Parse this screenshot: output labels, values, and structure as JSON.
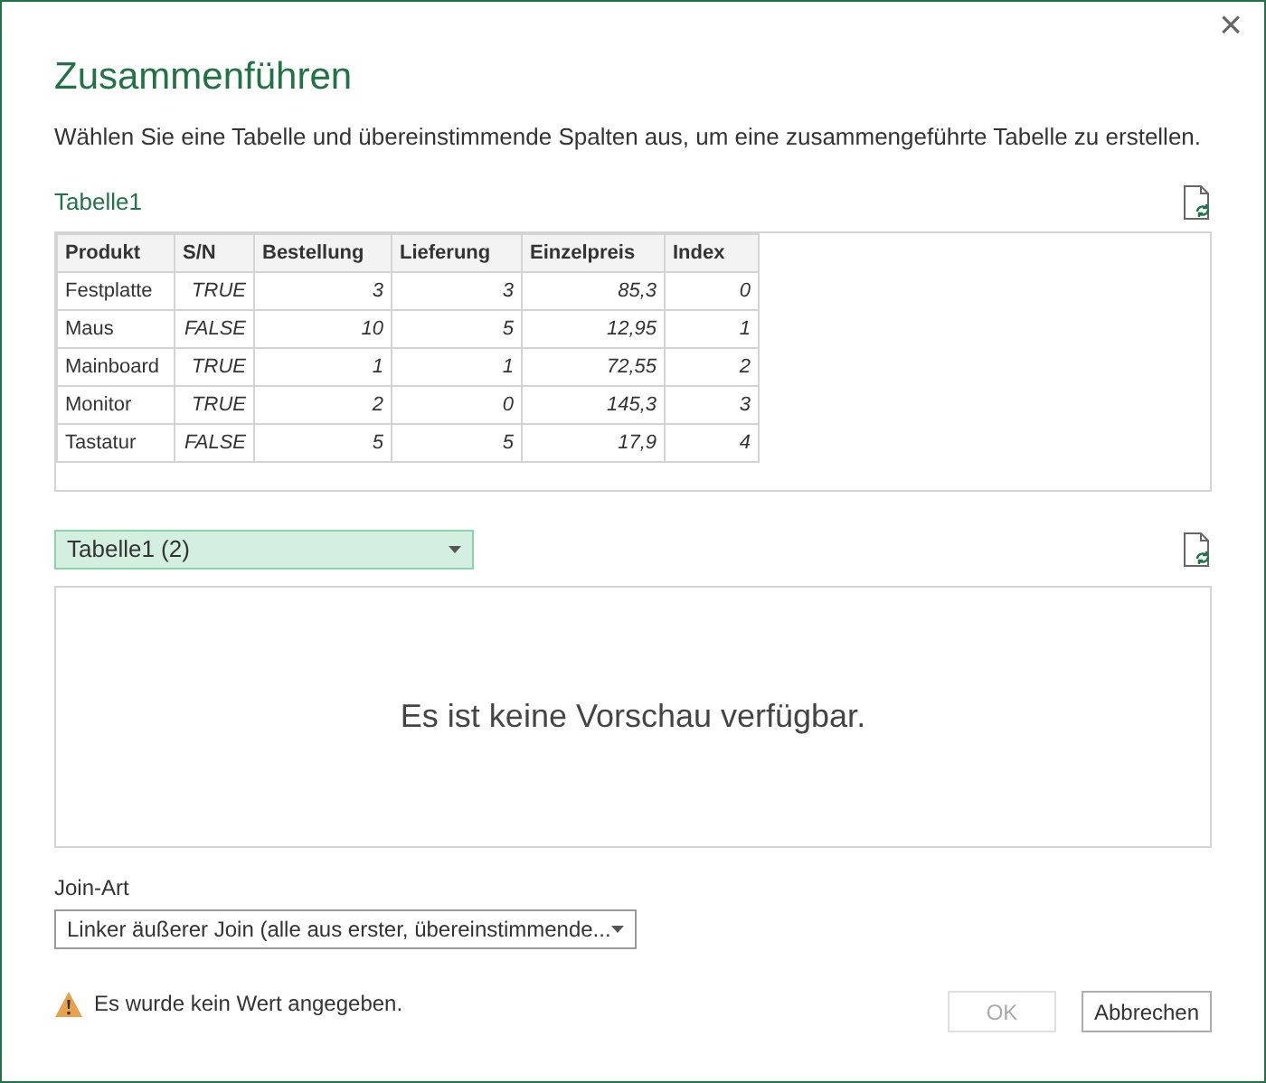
{
  "dialog": {
    "title": "Zusammenführen",
    "close": "×",
    "description": "Wählen Sie eine Tabelle und übereinstimmende Spalten aus, um eine zusammengeführte Tabelle zu erstellen."
  },
  "first_table": {
    "name": "Tabelle1",
    "columns": [
      {
        "label": "Produkt",
        "kind": "text"
      },
      {
        "label": "S/N",
        "kind": "value"
      },
      {
        "label": "Bestellung",
        "kind": "value"
      },
      {
        "label": "Lieferung",
        "kind": "value"
      },
      {
        "label": "Einzelpreis",
        "kind": "value"
      },
      {
        "label": "Index",
        "kind": "value"
      }
    ],
    "rows": [
      [
        "Festplatte",
        "TRUE",
        "3",
        "3",
        "85,3",
        "0"
      ],
      [
        "Maus",
        "FALSE",
        "10",
        "5",
        "12,95",
        "1"
      ],
      [
        "Mainboard",
        "TRUE",
        "1",
        "1",
        "72,55",
        "2"
      ],
      [
        "Monitor",
        "TRUE",
        "2",
        "0",
        "145,3",
        "3"
      ],
      [
        "Tastatur",
        "FALSE",
        "5",
        "5",
        "17,9",
        "4"
      ]
    ]
  },
  "second_table": {
    "value": "Tabelle1 (2)",
    "preview_message": "Es ist keine Vorschau verfügbar."
  },
  "join_type": {
    "label": "Join-Art",
    "value": "Linker äußerer Join (alle aus erster, übereinstimmende..."
  },
  "warning": "Es wurde kein Wert angegeben.",
  "buttons": [
    {
      "label": "OK",
      "disabled": true
    },
    {
      "label": "Abbrechen",
      "disabled": false
    }
  ]
}
